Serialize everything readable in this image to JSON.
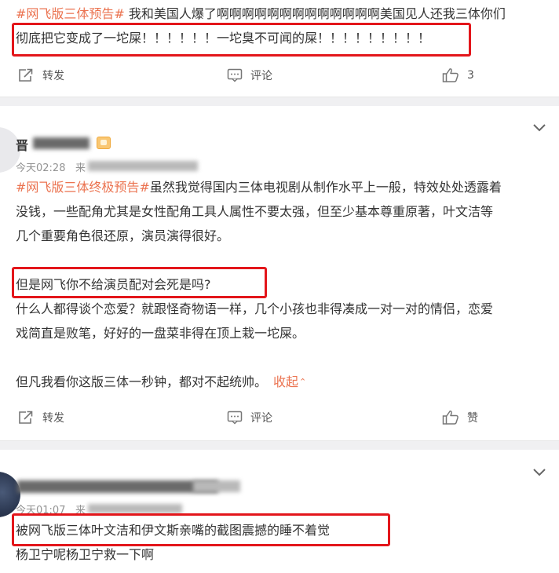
{
  "post1": {
    "topic": "#网飞版三体预告#",
    "text_line1": " 我和美国人爆了啊啊啊啊啊啊啊啊啊啊啊啊啊美国见人还我三体你们",
    "text_line2": "彻底把它变成了一坨屎！！！！！！一坨臭不可闻的屎！！！！！！！！！",
    "actions": {
      "repost": "转发",
      "comment": "评论",
      "like": "3"
    }
  },
  "post2": {
    "author_fragment": "晋",
    "time": "今天02:28",
    "source_fragment": "来",
    "topic": "#网飞版三体终极预告#",
    "para1": [
      "虽然我觉得国内三体电视剧从制作水平上一般，特效处处透露着",
      "没钱，一些配角尤其是女性配角工具人属性不要太强，但至少基本尊重原著，叶文洁等",
      "几个重要角色很还原，演员演得很好。"
    ],
    "para2": [
      "但是网飞你不给演员配对会死是吗?",
      "什么人都得谈个恋爱？就跟怪奇物语一样，几个小孩也非得凑成一对一对的情侣，恋爱",
      "戏简直是败笔，好好的一盘菜非得在顶上栽一坨屎。"
    ],
    "para3": "但凡我看你这版三体一秒钟，都对不起统帅。",
    "fold_label": "收起",
    "actions": {
      "repost": "转发",
      "comment": "评论",
      "like": "赞"
    }
  },
  "post3": {
    "time": "今天01:07",
    "source_fragment": "来",
    "line1": "被网飞版三体叶文洁和伊文斯亲嘴的截图震撼的睡不着觉",
    "line2": "杨卫宁呢杨卫宁救一下啊"
  },
  "colors": {
    "accent": "#eb7350",
    "highlight_border": "#e3161b",
    "divider": "#f0f0f2"
  }
}
